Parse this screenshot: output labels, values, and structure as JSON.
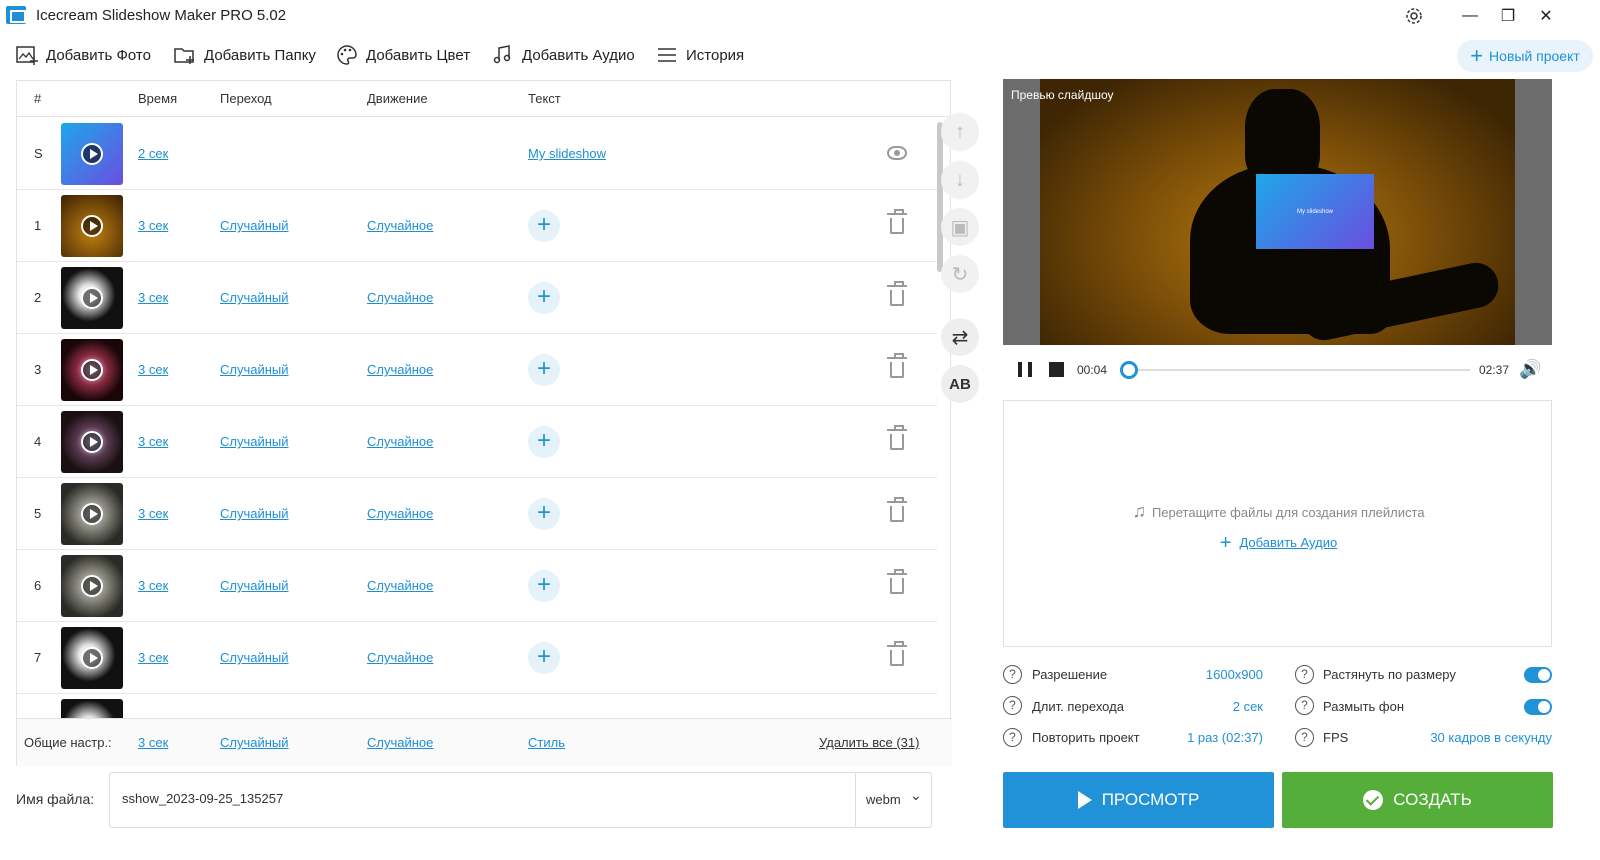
{
  "app": {
    "title": "Icecream Slideshow Maker PRO 5.02"
  },
  "toolbar": {
    "add_photo": "Добавить Фото",
    "add_folder": "Добавить Папку",
    "add_color": "Добавить Цвет",
    "add_audio": "Добавить Аудио",
    "history": "История",
    "new_project": "Новый проект"
  },
  "table": {
    "headers": {
      "num": "#",
      "time": "Время",
      "transition": "Переход",
      "motion": "Движение",
      "text": "Текст"
    },
    "title_row": {
      "num": "S",
      "time": "2 сек",
      "text": "My slideshow"
    },
    "rows": [
      {
        "num": "1",
        "time": "3 сек",
        "transition": "Случайный",
        "motion": "Случайное"
      },
      {
        "num": "2",
        "time": "3 сек",
        "transition": "Случайный",
        "motion": "Случайное"
      },
      {
        "num": "3",
        "time": "3 сек",
        "transition": "Случайный",
        "motion": "Случайное"
      },
      {
        "num": "4",
        "time": "3 сек",
        "transition": "Случайный",
        "motion": "Случайное"
      },
      {
        "num": "5",
        "time": "3 сек",
        "transition": "Случайный",
        "motion": "Случайное"
      },
      {
        "num": "6",
        "time": "3 сек",
        "transition": "Случайный",
        "motion": "Случайное"
      },
      {
        "num": "7",
        "time": "3 сек",
        "transition": "Случайный",
        "motion": "Случайное"
      }
    ],
    "footer": {
      "label": "Общие настр.:",
      "time": "3 сек",
      "transition": "Случайный",
      "motion": "Случайное",
      "style": "Стиль",
      "delete_all": "Удалить все (31)"
    }
  },
  "preview": {
    "label": "Превью слайдшоу",
    "slide_text": "My slideshow",
    "current_time": "00:04",
    "total_time": "02:37",
    "progress": 0.025
  },
  "audio": {
    "drop_text": "Перетащите файлы для создания плейлиста",
    "add_audio": "Добавить Аудио"
  },
  "settings": {
    "resolution_label": "Разрешение",
    "resolution_value": "1600x900",
    "transition_len_label": "Длит. перехода",
    "transition_len_value": "2 сек",
    "repeat_label": "Повторить проект",
    "repeat_value": "1 раз (02:37)",
    "stretch_label": "Растянуть по размеру",
    "stretch_on": true,
    "blur_label": "Размыть фон",
    "blur_on": true,
    "fps_label": "FPS",
    "fps_value": "30 кадров в секунду"
  },
  "file": {
    "label": "Имя файла:",
    "name": "sshow_2023-09-25_135257",
    "format": "webm"
  },
  "actions": {
    "preview": "ПРОСМОТР",
    "create": "СОЗДАТЬ"
  },
  "colors": {
    "accent": "#2191d8",
    "create_green": "#55ad3a"
  }
}
